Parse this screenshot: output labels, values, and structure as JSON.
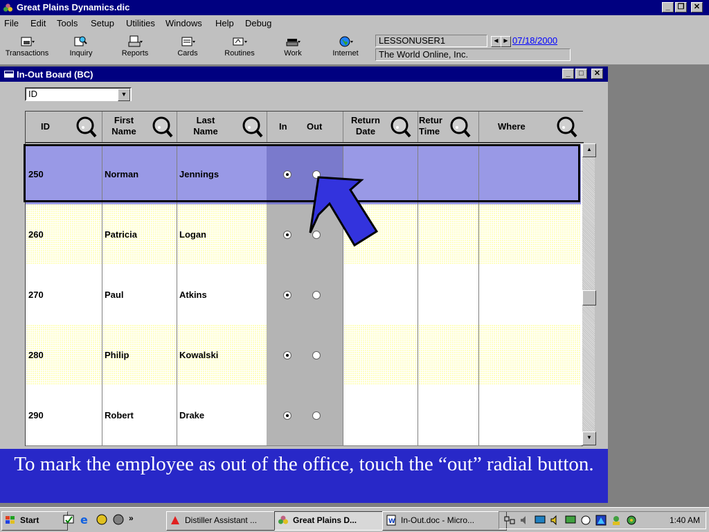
{
  "app": {
    "title": "Great Plains Dynamics.dic",
    "controls": {
      "minimize": "_",
      "restore": "❐",
      "close": "✕"
    }
  },
  "menu": [
    "File",
    "Edit",
    "Tools",
    "Setup",
    "Utilities",
    "Windows",
    "Help",
    "Debug"
  ],
  "toolbar": {
    "buttons": [
      "Transactions",
      "Inquiry",
      "Reports",
      "Cards",
      "Routines",
      "Work",
      "Internet"
    ],
    "user": "LESSONUSER1",
    "date": "07/18/2000",
    "company": "The World Online, Inc."
  },
  "window": {
    "title": "In-Out Board (BC)",
    "controls": {
      "minimize": "_",
      "maximize": "□",
      "close": "✕"
    },
    "sort_by": "ID"
  },
  "grid": {
    "headers": {
      "id": "ID",
      "first": "First Name",
      "last": "Last Name",
      "in": "In",
      "out": "Out",
      "return_date": "Return Date",
      "return_time": "Retur Time",
      "where": "Where"
    },
    "rows": [
      {
        "id": "250",
        "first": "Norman",
        "last": "Jennings",
        "status": "in",
        "style": "selected"
      },
      {
        "id": "260",
        "first": "Patricia",
        "last": "Logan",
        "status": "in",
        "style": "yellow"
      },
      {
        "id": "270",
        "first": "Paul",
        "last": "Atkins",
        "status": "in",
        "style": "white"
      },
      {
        "id": "280",
        "first": "Philip",
        "last": "Kowalski",
        "status": "in",
        "style": "yellow"
      },
      {
        "id": "290",
        "first": "Robert",
        "last": "Drake",
        "status": "in",
        "style": "white"
      }
    ]
  },
  "caption": "To mark the employee as out of the office, touch the “out” radial button.",
  "taskbar": {
    "start": "Start",
    "more": "»",
    "tasks": [
      "Distiller Assistant ...",
      "Great Plains D...",
      "In-Out.doc - Micro..."
    ],
    "clock": "1:40 AM"
  },
  "colors": {
    "titlebar": "#000080",
    "selected_row": "#9999e6",
    "caption_bg": "#2828c8",
    "arrow": "#3333dd"
  }
}
